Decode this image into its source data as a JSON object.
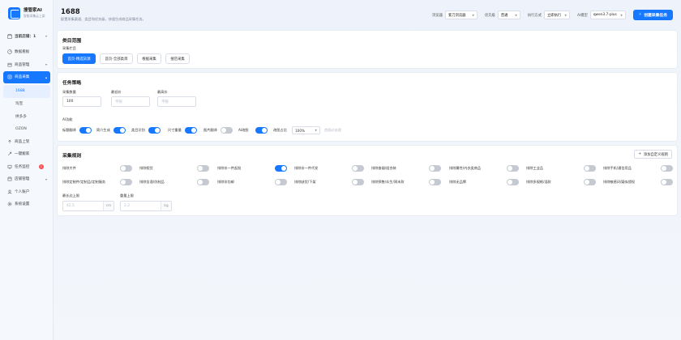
{
  "app": {
    "name": "搜管家AI",
    "tagline": "智能采集云上架"
  },
  "sidebar": {
    "shop_selector": "当前店铺：1",
    "items": [
      {
        "label": "数据看板",
        "icon": "dashboard-icon"
      },
      {
        "label": "商品管理",
        "icon": "box-icon"
      },
      {
        "label": "商品采集",
        "icon": "collect-icon"
      },
      {
        "label": "商品上架",
        "icon": "upload-icon"
      },
      {
        "label": "一键搬家",
        "icon": "move-icon"
      },
      {
        "label": "任务监控",
        "icon": "monitor-icon",
        "badge": "1"
      },
      {
        "label": "店铺管理",
        "icon": "store-icon"
      },
      {
        "label": "个人账户",
        "icon": "user-icon"
      },
      {
        "label": "系统设置",
        "icon": "settings-icon"
      }
    ],
    "sub_items": [
      "1688",
      "淘宝",
      "拼多多",
      "OZON"
    ]
  },
  "header": {
    "title": "1688",
    "subtitle": "配置采集渠道、类目和优先级，快速生成商品采集任务。",
    "browser_label": "浏览器",
    "browser_value": "紫刀浏览器",
    "priority_label": "优先级",
    "priority_value": "普通",
    "exec_label": "执行方式",
    "exec_value": "立即执行",
    "model_label": "AI模型",
    "model_value": "qwen3.7-plus",
    "create_button": "创建采集任务"
  },
  "category": {
    "title": "类目范围",
    "column_label": "采集栏目",
    "options": [
      {
        "label": "首页-精选货源",
        "selected": true
      },
      {
        "label": "首页-全部类目",
        "selected": false
      },
      {
        "label": "根据采集",
        "selected": false
      },
      {
        "label": "搜店采集",
        "selected": false
      }
    ]
  },
  "strategy": {
    "title": "任务策略",
    "count_label": "采集数量",
    "count_value": "100",
    "min_price_label": "最低价",
    "min_price_placeholder": "不限",
    "max_price_label": "最高价",
    "max_price_placeholder": "不限",
    "ai_label": "AI功能",
    "toggles": [
      {
        "label": "标题翻译",
        "on": true
      },
      {
        "label": "简介生成",
        "on": true
      },
      {
        "label": "类目识别",
        "on": true
      },
      {
        "label": "尺寸重量",
        "on": true
      },
      {
        "label": "图片翻译",
        "on": false
      },
      {
        "label": "AI改图",
        "on": true
      }
    ],
    "ratio_label": "改图占比",
    "ratio_value": "100%",
    "ratio_hint": "首图必处理"
  },
  "rules": {
    "title": "采集规则",
    "add_button": "添加自定义规则",
    "row1": [
      {
        "label": "排除大件",
        "on": false
      },
      {
        "label": "排除假货",
        "on": false
      },
      {
        "label": "排除非一件起批",
        "on": true
      },
      {
        "label": "排除非一件代发",
        "on": false
      },
      {
        "label": "排除香烟/组合装",
        "on": false
      },
      {
        "label": "排除属性/内衣类商品",
        "on": false
      },
      {
        "label": "排除工业品",
        "on": false
      },
      {
        "label": "排除手机/通信用品",
        "on": false
      }
    ],
    "row2": [
      {
        "label": "排除定制件/定制品/定制服务",
        "on": false
      },
      {
        "label": "排除含酒/仿制品",
        "on": false
      },
      {
        "label": "排除非包邮",
        "on": false
      },
      {
        "label": "排除缺货/下架",
        "on": false
      },
      {
        "label": "排除预售/众生/周末款",
        "on": false
      },
      {
        "label": "排除无品牌",
        "on": false
      },
      {
        "label": "排除多规格/混款",
        "on": false
      },
      {
        "label": "排除敏感词/疑似侵权",
        "on": false
      }
    ],
    "max_length_label": "最长边上限",
    "max_length_placeholder": "42.5",
    "max_length_unit": "cm",
    "weight_label": "重量上限",
    "weight_placeholder": "2.2",
    "weight_unit": "kg"
  },
  "colors": {
    "primary": "#1677ff",
    "badge": "#ff4d4f"
  }
}
